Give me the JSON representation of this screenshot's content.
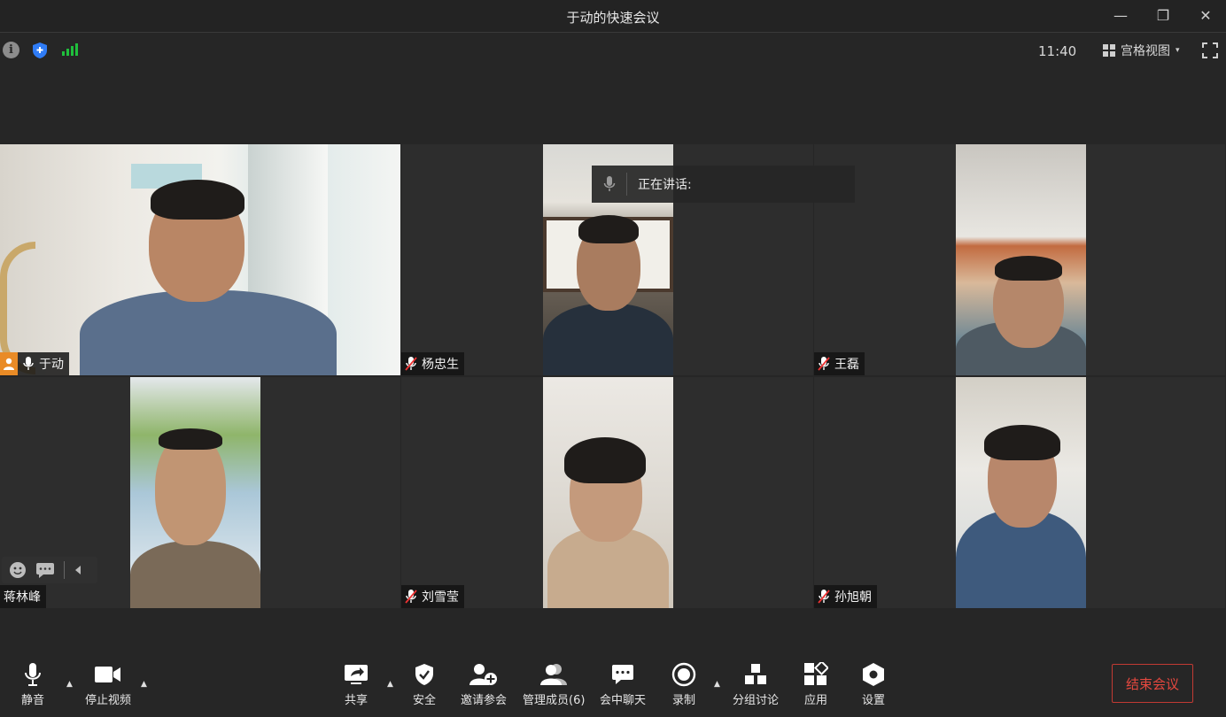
{
  "window": {
    "title": "于动的快速会议",
    "minimize": "—",
    "restore": "❐",
    "close": "✕"
  },
  "info_bar": {
    "info_glyph": "i",
    "time": "11:40",
    "view_mode": "宫格视图",
    "view_caret": "▾"
  },
  "colors": {
    "accent_blue": "#2f7cf6",
    "signal_green": "#1fbf3c",
    "host_orange": "#e98b26",
    "end_red": "#e5483f"
  },
  "speaking": {
    "label": "正在讲话:"
  },
  "participants": [
    {
      "name": "于动",
      "muted": false,
      "host": true
    },
    {
      "name": "杨忠生",
      "muted": true
    },
    {
      "name": "王磊",
      "muted": true
    },
    {
      "name": "蒋林峰",
      "muted": false
    },
    {
      "name": "刘雪莹",
      "muted": true
    },
    {
      "name": "孙旭朝",
      "muted": true
    }
  ],
  "toolbar": {
    "mute": "静音",
    "stop_video": "停止视频",
    "share": "共享",
    "security": "安全",
    "invite": "邀请参会",
    "manage_members": "管理成员(6)",
    "chat": "会中聊天",
    "record": "录制",
    "breakout": "分组讨论",
    "apps": "应用",
    "settings": "设置",
    "end_meeting": "结束会议",
    "caret": "▲"
  },
  "icons": [
    "info-icon",
    "shield-icon",
    "signal-icon",
    "grid-view-icon",
    "fullscreen-icon",
    "mic-icon",
    "mic-muted-icon",
    "host-icon",
    "smile-icon",
    "chat-bubble-icon",
    "collapse-left-icon",
    "camera-icon",
    "share-icon",
    "shield-check-icon",
    "add-user-icon",
    "members-icon",
    "chat-icon",
    "record-icon",
    "breakout-icon",
    "apps-icon",
    "settings-icon"
  ]
}
